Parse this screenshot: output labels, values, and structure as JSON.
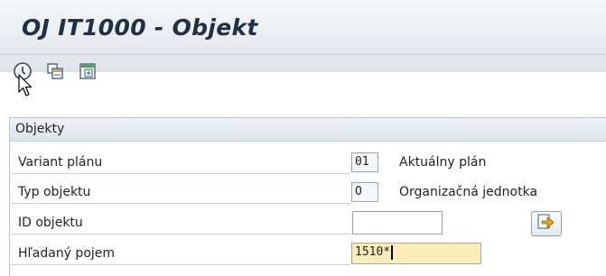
{
  "window": {
    "title": "OJ IT1000 - Objekt"
  },
  "toolbar": {
    "buttons": [
      {
        "icon": "create-icon"
      },
      {
        "icon": "copy-icon"
      },
      {
        "icon": "overview-icon"
      }
    ]
  },
  "group": {
    "title": "Objekty",
    "rows": [
      {
        "label": "Variant plánu",
        "value": "01",
        "description": "Aktuálny plán"
      },
      {
        "label": "Typ objektu",
        "value": "O",
        "description": "Organizačná jednotka"
      },
      {
        "label": "ID objektu",
        "value": ""
      },
      {
        "label": "Hľadaný pojem",
        "value": "1510*"
      }
    ]
  },
  "colors": {
    "title_text": "#1f2f44",
    "focus_field": "#fcecb7",
    "search_icon": "#d99a10"
  }
}
